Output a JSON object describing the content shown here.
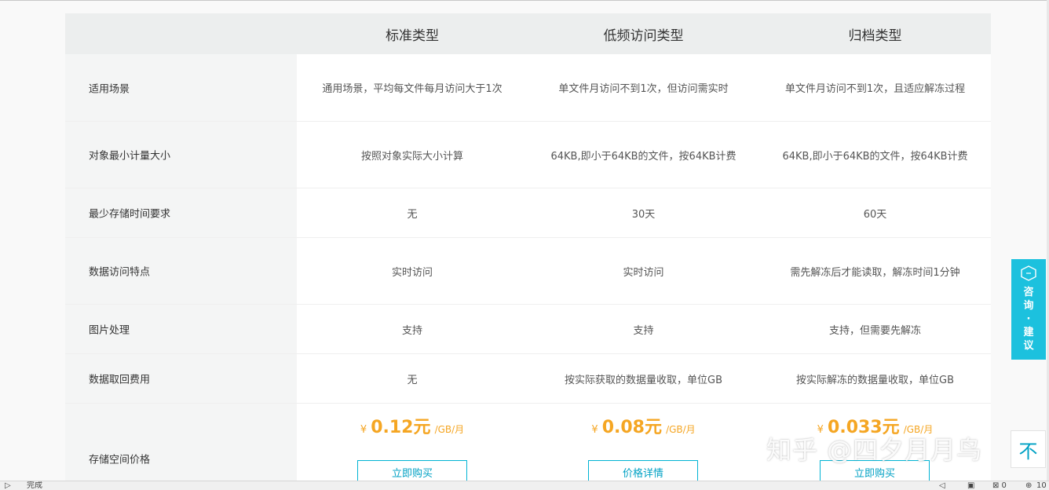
{
  "table": {
    "headers": [
      "标准类型",
      "低频访问类型",
      "归档类型"
    ],
    "rows": [
      {
        "label": "适用场景",
        "values": [
          "通用场景，平均每文件每月访问大于1次",
          "单文件月访问不到1次，但访问需实时",
          "单文件月访问不到1次，且适应解冻过程"
        ]
      },
      {
        "label": "对象最小计量大小",
        "values": [
          "按照对象实际大小计算",
          "64KB,即小于64KB的文件，按64KB计费",
          "64KB,即小于64KB的文件，按64KB计费"
        ]
      },
      {
        "label": "最少存储时间要求",
        "values": [
          "无",
          "30天",
          "60天"
        ]
      },
      {
        "label": "数据访问特点",
        "values": [
          "实时访问",
          "实时访问",
          "需先解冻后才能读取，解冻时间1分钟"
        ]
      },
      {
        "label": "图片处理",
        "values": [
          "支持",
          "支持",
          "支持，但需要先解冻"
        ]
      },
      {
        "label": "数据取回费用",
        "values": [
          "无",
          "按实际获取的数据量收取，单位GB",
          "按实际解冻的数据量收取，单位GB"
        ]
      }
    ],
    "price_row": {
      "label": "存储空间价格",
      "prices": [
        {
          "currency": "¥",
          "amount": "0.12元",
          "unit": "/GB/月",
          "button": "立即购买"
        },
        {
          "currency": "¥",
          "amount": "0.08元",
          "unit": "/GB/月",
          "button": "价格详情"
        },
        {
          "currency": "¥",
          "amount": "0.033元",
          "unit": "/GB/月",
          "button": "立即购买"
        }
      ]
    }
  },
  "float_consult": {
    "label": "咨询·建议"
  },
  "watermark": "知乎 @四夕月月鸟",
  "back_to_top": "不",
  "statusbar": {
    "status": "完成",
    "zoom": "10"
  },
  "colors": {
    "accent": "#1cc1de",
    "price": "#f5a623",
    "button_border": "#00b3d4"
  }
}
